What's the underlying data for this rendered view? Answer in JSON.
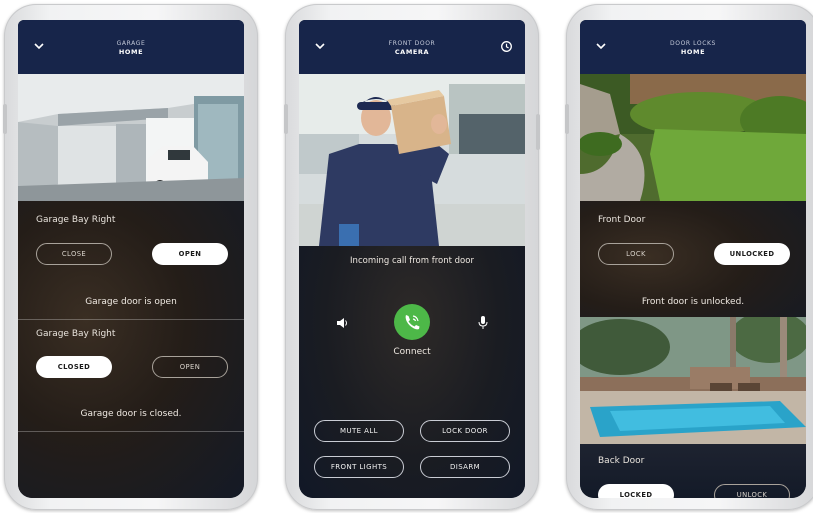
{
  "phones": [
    {
      "header": {
        "line1": "GARAGE",
        "line2": "HOME"
      },
      "sections": [
        {
          "label": "Garage Bay Right",
          "left_btn": "CLOSE",
          "right_btn": "OPEN",
          "status": "Garage door is open"
        },
        {
          "label": "Garage Bay Right",
          "left_btn": "CLOSED",
          "right_btn": "OPEN",
          "status": "Garage door is closed."
        }
      ]
    },
    {
      "header": {
        "line1": "FRONT DOOR",
        "line2": "CAMERA"
      },
      "incoming": "Incoming call from front door",
      "connect": "Connect",
      "buttons": [
        "MUTE ALL",
        "LOCK DOOR",
        "FRONT LIGHTS",
        "DISARM"
      ]
    },
    {
      "header": {
        "line1": "DOOR LOCKS",
        "line2": "HOME"
      },
      "sections": [
        {
          "label": "Front Door",
          "left_btn": "LOCK",
          "right_btn": "UNLOCKED",
          "status": "Front door is unlocked."
        },
        {
          "label": "Back Door",
          "left_btn": "LOCKED",
          "right_btn": "UNLOCK"
        }
      ]
    }
  ],
  "colors": {
    "header": "#17254a",
    "accent_green": "#4db848",
    "background": "#ffffff"
  }
}
